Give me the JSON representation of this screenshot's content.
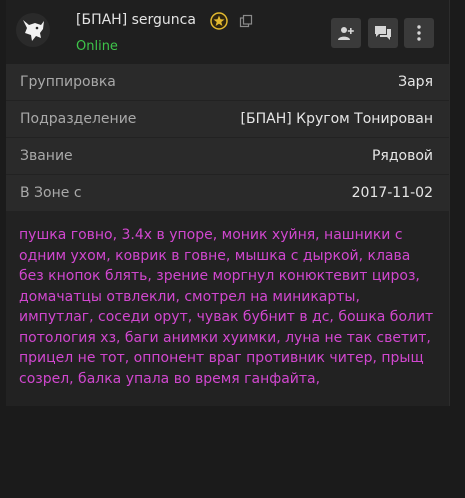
{
  "profile": {
    "name": "[БПАН] sergunca",
    "status": "Online",
    "colors": {
      "status": "#3ec54a",
      "bio": "#d147cf",
      "rank_badge": "#e2b92f"
    }
  },
  "header_buttons": [
    {
      "icon": "add-user-icon"
    },
    {
      "icon": "chat-icon"
    },
    {
      "icon": "more-vertical-icon"
    }
  ],
  "fields": [
    {
      "label": "Группировка",
      "value": "Заря"
    },
    {
      "label": "Подразделение",
      "value": "[БПАН] Кругом Тонирован"
    },
    {
      "label": "Звание",
      "value": "Рядовой"
    },
    {
      "label": "В Зоне с",
      "value": "2017-11-02"
    }
  ],
  "bio_lines": [
    "пушка говно, 3.4х в упоре, моник хуйня, нашники с",
    "одним ухом, коврик в говне, мышка с дыркой, клава",
    "без кнопок блять, зрение моргнул конюктевит цироз,",
    "домачатцы отвлекли, смотрел на миникарты,",
    "импутлаг, соседи орут, чувак бубнит в дс, бошка болит",
    "потология хз, баги анимки хуимки, луна не так светит,",
    "прицел не тот, оппонент враг противник читер, прыщ",
    "созрел, балка упала во время ганфайта,"
  ]
}
